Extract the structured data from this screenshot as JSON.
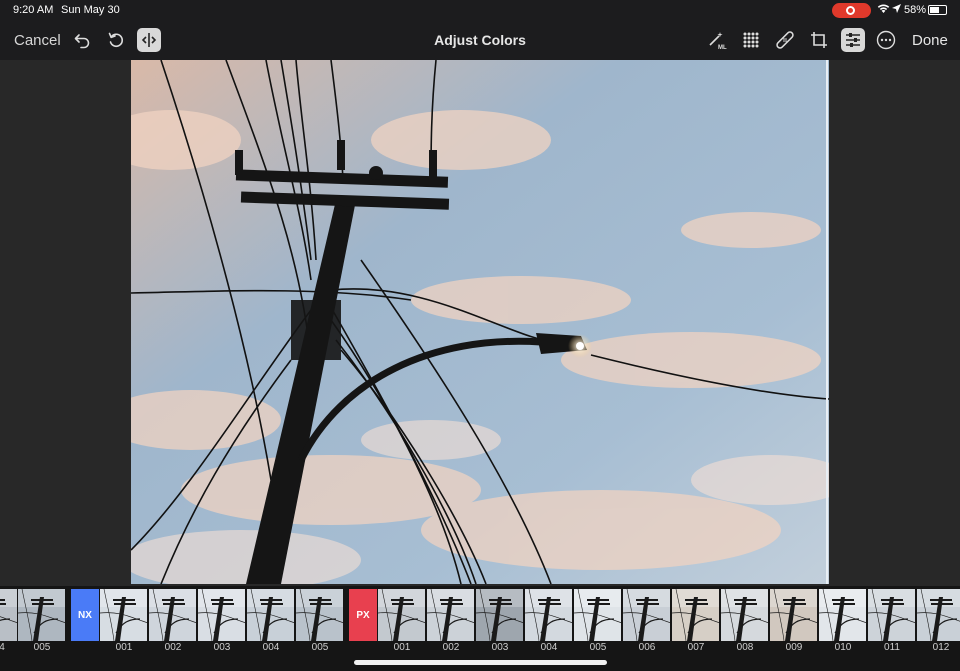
{
  "status_bar": {
    "time": "9:20 AM",
    "date": "Sun May 30",
    "battery": "58%"
  },
  "toolbar": {
    "cancel_label": "Cancel",
    "title": "Adjust Colors",
    "done_label": "Done",
    "icons": [
      "undo-icon",
      "revert-icon",
      "split-compare-icon",
      "ml-magic-wand-icon",
      "grid-icon",
      "bandage-icon",
      "crop-icon",
      "adjust-sliders-icon",
      "more-icon"
    ],
    "active_tool": "adjust-sliders-icon"
  },
  "filmstrip": {
    "nx_label": "NX",
    "px_label": "PX",
    "nx_color": "#4a7bf7",
    "px_color": "#e8404f",
    "labels": [
      "4",
      "005",
      "001",
      "002",
      "003",
      "004",
      "005",
      "001",
      "002",
      "003",
      "004",
      "005",
      "006",
      "007",
      "008",
      "009",
      "010",
      "011",
      "012"
    ]
  },
  "colors": {
    "background": "#1c1c1e",
    "canvas": "#282828",
    "recording": "#e0392b"
  }
}
